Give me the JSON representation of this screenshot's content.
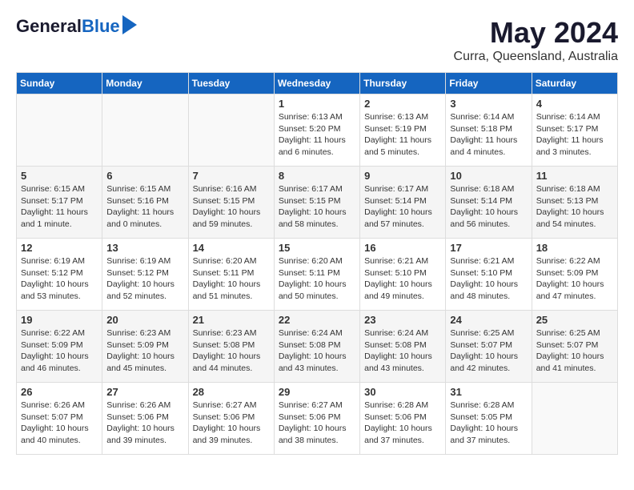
{
  "logo": {
    "general": "General",
    "blue": "Blue"
  },
  "header": {
    "month_year": "May 2024",
    "location": "Curra, Queensland, Australia"
  },
  "weekdays": [
    "Sunday",
    "Monday",
    "Tuesday",
    "Wednesday",
    "Thursday",
    "Friday",
    "Saturday"
  ],
  "weeks": [
    [
      {
        "day": "",
        "content": ""
      },
      {
        "day": "",
        "content": ""
      },
      {
        "day": "",
        "content": ""
      },
      {
        "day": "1",
        "content": "Sunrise: 6:13 AM\nSunset: 5:20 PM\nDaylight: 11 hours and 6 minutes."
      },
      {
        "day": "2",
        "content": "Sunrise: 6:13 AM\nSunset: 5:19 PM\nDaylight: 11 hours and 5 minutes."
      },
      {
        "day": "3",
        "content": "Sunrise: 6:14 AM\nSunset: 5:18 PM\nDaylight: 11 hours and 4 minutes."
      },
      {
        "day": "4",
        "content": "Sunrise: 6:14 AM\nSunset: 5:17 PM\nDaylight: 11 hours and 3 minutes."
      }
    ],
    [
      {
        "day": "5",
        "content": "Sunrise: 6:15 AM\nSunset: 5:17 PM\nDaylight: 11 hours and 1 minute."
      },
      {
        "day": "6",
        "content": "Sunrise: 6:15 AM\nSunset: 5:16 PM\nDaylight: 11 hours and 0 minutes."
      },
      {
        "day": "7",
        "content": "Sunrise: 6:16 AM\nSunset: 5:15 PM\nDaylight: 10 hours and 59 minutes."
      },
      {
        "day": "8",
        "content": "Sunrise: 6:17 AM\nSunset: 5:15 PM\nDaylight: 10 hours and 58 minutes."
      },
      {
        "day": "9",
        "content": "Sunrise: 6:17 AM\nSunset: 5:14 PM\nDaylight: 10 hours and 57 minutes."
      },
      {
        "day": "10",
        "content": "Sunrise: 6:18 AM\nSunset: 5:14 PM\nDaylight: 10 hours and 56 minutes."
      },
      {
        "day": "11",
        "content": "Sunrise: 6:18 AM\nSunset: 5:13 PM\nDaylight: 10 hours and 54 minutes."
      }
    ],
    [
      {
        "day": "12",
        "content": "Sunrise: 6:19 AM\nSunset: 5:12 PM\nDaylight: 10 hours and 53 minutes."
      },
      {
        "day": "13",
        "content": "Sunrise: 6:19 AM\nSunset: 5:12 PM\nDaylight: 10 hours and 52 minutes."
      },
      {
        "day": "14",
        "content": "Sunrise: 6:20 AM\nSunset: 5:11 PM\nDaylight: 10 hours and 51 minutes."
      },
      {
        "day": "15",
        "content": "Sunrise: 6:20 AM\nSunset: 5:11 PM\nDaylight: 10 hours and 50 minutes."
      },
      {
        "day": "16",
        "content": "Sunrise: 6:21 AM\nSunset: 5:10 PM\nDaylight: 10 hours and 49 minutes."
      },
      {
        "day": "17",
        "content": "Sunrise: 6:21 AM\nSunset: 5:10 PM\nDaylight: 10 hours and 48 minutes."
      },
      {
        "day": "18",
        "content": "Sunrise: 6:22 AM\nSunset: 5:09 PM\nDaylight: 10 hours and 47 minutes."
      }
    ],
    [
      {
        "day": "19",
        "content": "Sunrise: 6:22 AM\nSunset: 5:09 PM\nDaylight: 10 hours and 46 minutes."
      },
      {
        "day": "20",
        "content": "Sunrise: 6:23 AM\nSunset: 5:09 PM\nDaylight: 10 hours and 45 minutes."
      },
      {
        "day": "21",
        "content": "Sunrise: 6:23 AM\nSunset: 5:08 PM\nDaylight: 10 hours and 44 minutes."
      },
      {
        "day": "22",
        "content": "Sunrise: 6:24 AM\nSunset: 5:08 PM\nDaylight: 10 hours and 43 minutes."
      },
      {
        "day": "23",
        "content": "Sunrise: 6:24 AM\nSunset: 5:08 PM\nDaylight: 10 hours and 43 minutes."
      },
      {
        "day": "24",
        "content": "Sunrise: 6:25 AM\nSunset: 5:07 PM\nDaylight: 10 hours and 42 minutes."
      },
      {
        "day": "25",
        "content": "Sunrise: 6:25 AM\nSunset: 5:07 PM\nDaylight: 10 hours and 41 minutes."
      }
    ],
    [
      {
        "day": "26",
        "content": "Sunrise: 6:26 AM\nSunset: 5:07 PM\nDaylight: 10 hours and 40 minutes."
      },
      {
        "day": "27",
        "content": "Sunrise: 6:26 AM\nSunset: 5:06 PM\nDaylight: 10 hours and 39 minutes."
      },
      {
        "day": "28",
        "content": "Sunrise: 6:27 AM\nSunset: 5:06 PM\nDaylight: 10 hours and 39 minutes."
      },
      {
        "day": "29",
        "content": "Sunrise: 6:27 AM\nSunset: 5:06 PM\nDaylight: 10 hours and 38 minutes."
      },
      {
        "day": "30",
        "content": "Sunrise: 6:28 AM\nSunset: 5:06 PM\nDaylight: 10 hours and 37 minutes."
      },
      {
        "day": "31",
        "content": "Sunrise: 6:28 AM\nSunset: 5:05 PM\nDaylight: 10 hours and 37 minutes."
      },
      {
        "day": "",
        "content": ""
      }
    ]
  ]
}
